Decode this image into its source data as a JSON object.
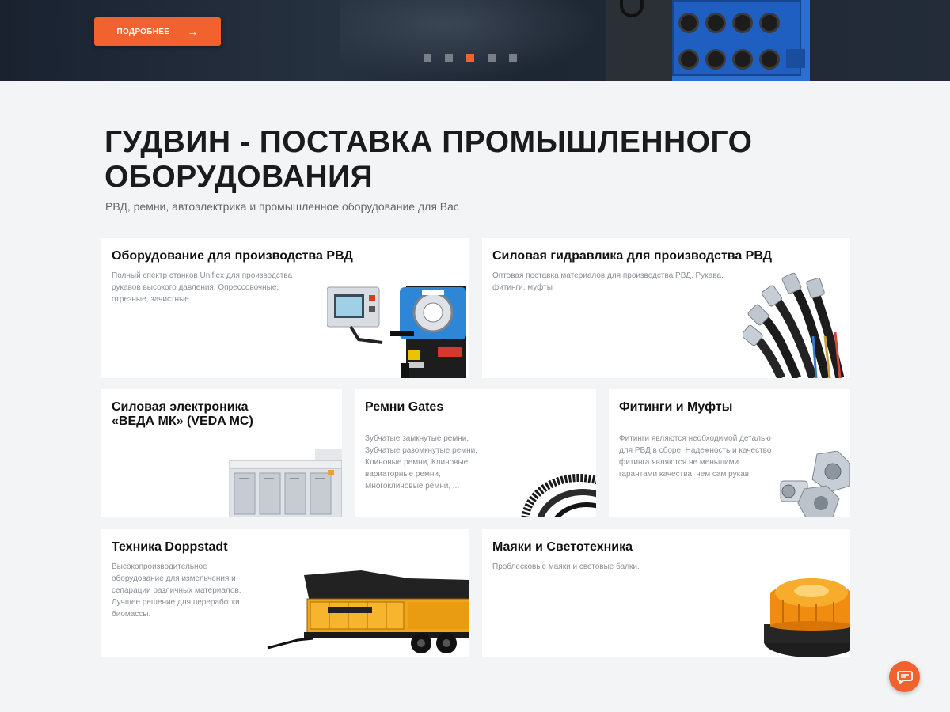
{
  "hero": {
    "button_label": "ПОДРОБНЕЕ",
    "button_arrow": "→",
    "slides_total": 5,
    "slide_active": 3
  },
  "page": {
    "title": "ГУДВИН - ПОСТАВКА ПРОМЫШЛЕННОГО ОБОРУДОВАНИЯ",
    "subtitle": "РВД, ремни, автоэлектрика и промышленное оборудование для Вас"
  },
  "cards": [
    {
      "title": "Оборудование для производства РВД",
      "text": "Полный спектр станков Uniflex для производства рукавов высокого давления. Опрессовочные, отрезные, зачистные."
    },
    {
      "title": "Силовая гидравлика для производства РВД",
      "text": "Оптовая поставка материалов для производства РВД. Рукава, фитинги, муфты"
    },
    {
      "title": "Силовая электроника «ВЕДА МК» (VEDA MC)",
      "text": ""
    },
    {
      "title": "Ремни Gates",
      "text": "Зубчатые замкнутые ремни, Зубчатые разомкнутые ремни, Клиновые ремни, Клиновые вариаторные ремни, Многоклиновые ремни, ..."
    },
    {
      "title": "Фитинги и Муфты",
      "text": "Фитинги являются необходимой деталью для РВД в сборе. Надежность и качество фитинга являются не меньшими гарантами качества, чем сам рукав."
    },
    {
      "title": "Техника Doppstadt",
      "text": "Высокопроизводительное оборудование для измельчения и сепарации различных материалов. Лучшее решение для переработки биомассы."
    },
    {
      "title": "Маяки и Светотехника",
      "text": "Проблесковые маяки и световые балки."
    }
  ],
  "colors": {
    "accent": "#f2622e",
    "background": "#f3f4f6",
    "card": "#ffffff"
  },
  "icons": {
    "chat": "chat-bubble-icon"
  }
}
